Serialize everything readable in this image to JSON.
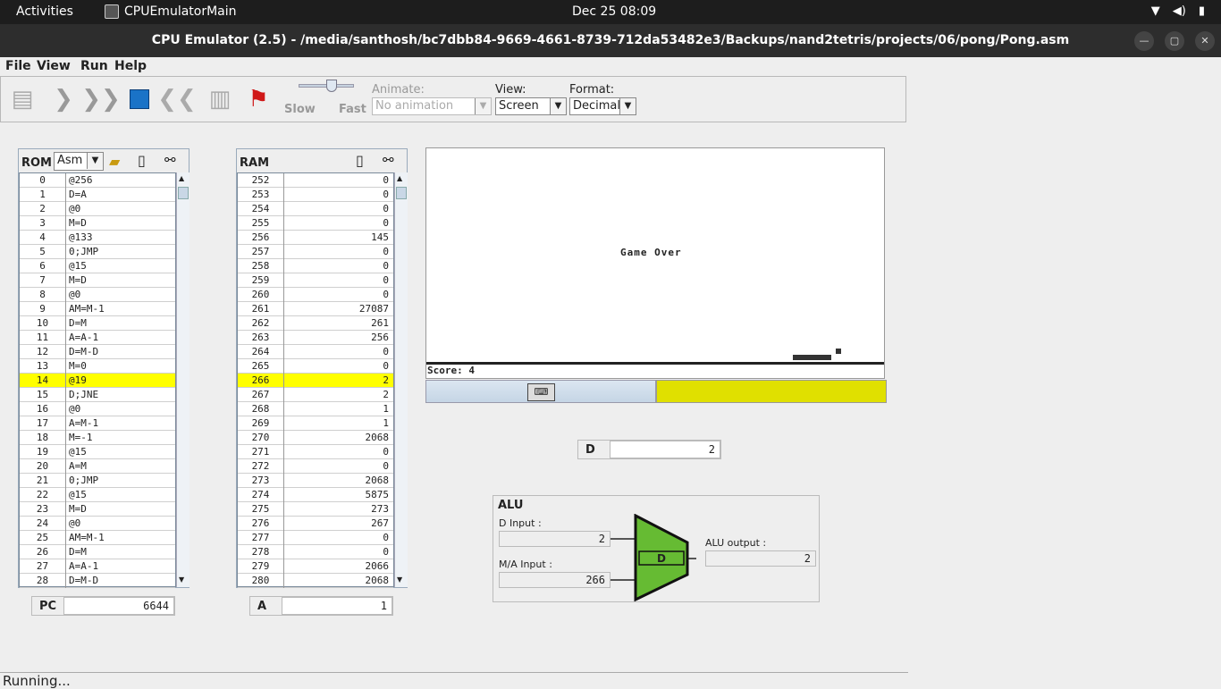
{
  "topbar": {
    "activities": "Activities",
    "app": "CPUEmulatorMain",
    "clock": "Dec 25  08:09"
  },
  "window": {
    "title": "CPU Emulator (2.5) - /media/santhosh/bc7dbb84-9669-4661-8739-712da53482e3/Backups/nand2tetris/projects/06/pong/Pong.asm"
  },
  "menu": {
    "file": "File",
    "view": "View",
    "run": "Run",
    "help": "Help"
  },
  "toolbar": {
    "slow": "Slow",
    "fast": "Fast",
    "speed_fraction": 0.55,
    "animate_label": "Animate:",
    "animate_value": "No animation",
    "view_label": "View:",
    "view_value": "Screen",
    "format_label": "Format:",
    "format_value": "Decimal"
  },
  "rom": {
    "title": "ROM",
    "mode": "Asm",
    "rows": [
      [
        "0",
        "@256"
      ],
      [
        "1",
        "D=A"
      ],
      [
        "2",
        "@0"
      ],
      [
        "3",
        "M=D"
      ],
      [
        "4",
        "@133"
      ],
      [
        "5",
        "0;JMP"
      ],
      [
        "6",
        "@15"
      ],
      [
        "7",
        "M=D"
      ],
      [
        "8",
        "@0"
      ],
      [
        "9",
        "AM=M-1"
      ],
      [
        "10",
        "D=M"
      ],
      [
        "11",
        "A=A-1"
      ],
      [
        "12",
        "D=M-D"
      ],
      [
        "13",
        "M=0"
      ],
      [
        "14",
        "@19"
      ],
      [
        "15",
        "D;JNE"
      ],
      [
        "16",
        "@0"
      ],
      [
        "17",
        "A=M-1"
      ],
      [
        "18",
        "M=-1"
      ],
      [
        "19",
        "@15"
      ],
      [
        "20",
        "A=M"
      ],
      [
        "21",
        "0;JMP"
      ],
      [
        "22",
        "@15"
      ],
      [
        "23",
        "M=D"
      ],
      [
        "24",
        "@0"
      ],
      [
        "25",
        "AM=M-1"
      ],
      [
        "26",
        "D=M"
      ],
      [
        "27",
        "A=A-1"
      ],
      [
        "28",
        "D=M-D"
      ]
    ],
    "highlight_index": 14
  },
  "pc": {
    "label": "PC",
    "value": "6644"
  },
  "ram": {
    "title": "RAM",
    "rows": [
      [
        "252",
        "0"
      ],
      [
        "253",
        "0"
      ],
      [
        "254",
        "0"
      ],
      [
        "255",
        "0"
      ],
      [
        "256",
        "145"
      ],
      [
        "257",
        "0"
      ],
      [
        "258",
        "0"
      ],
      [
        "259",
        "0"
      ],
      [
        "260",
        "0"
      ],
      [
        "261",
        "27087"
      ],
      [
        "262",
        "261"
      ],
      [
        "263",
        "256"
      ],
      [
        "264",
        "0"
      ],
      [
        "265",
        "0"
      ],
      [
        "266",
        "2"
      ],
      [
        "267",
        "2"
      ],
      [
        "268",
        "1"
      ],
      [
        "269",
        "1"
      ],
      [
        "270",
        "2068"
      ],
      [
        "271",
        "0"
      ],
      [
        "272",
        "0"
      ],
      [
        "273",
        "2068"
      ],
      [
        "274",
        "5875"
      ],
      [
        "275",
        "273"
      ],
      [
        "276",
        "267"
      ],
      [
        "277",
        "0"
      ],
      [
        "278",
        "0"
      ],
      [
        "279",
        "2066"
      ],
      [
        "280",
        "2068"
      ]
    ],
    "highlight_index": 14
  },
  "a_reg": {
    "label": "A",
    "value": "1"
  },
  "d_reg": {
    "label": "D",
    "value": "2"
  },
  "screen": {
    "message": "Game Over",
    "score": "Score: 4"
  },
  "alu": {
    "title": "ALU",
    "d_input_label": "D Input :",
    "d_input": "2",
    "ma_input_label": "M/A Input :",
    "ma_input": "266",
    "output_label": "ALU output :",
    "output": "2",
    "op": "D"
  },
  "status": {
    "text": "Running..."
  },
  "colors": {
    "highlight": "#ffff00",
    "alu": "#66bb33",
    "kbd_bar": "#e0e000"
  }
}
